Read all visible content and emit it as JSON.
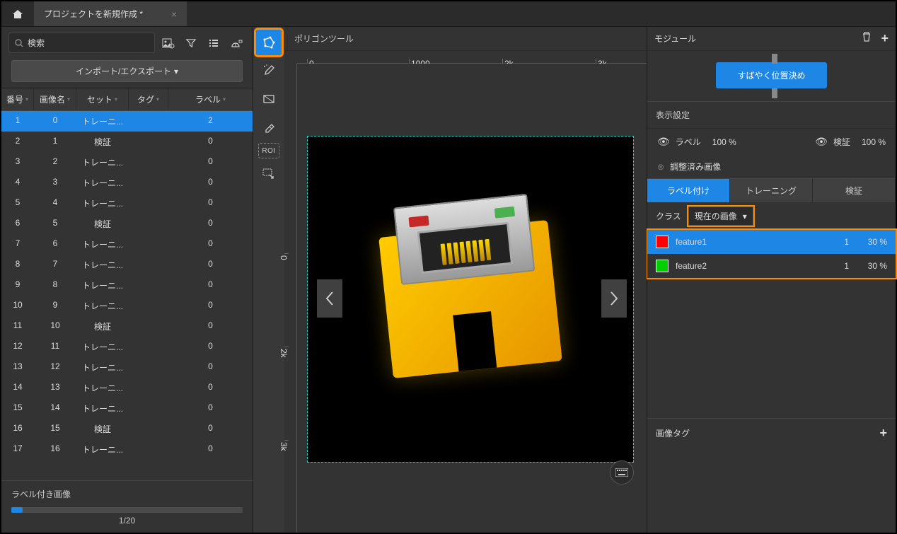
{
  "tab": {
    "title": "プロジェクトを新規作成 *"
  },
  "search": {
    "placeholder": "検索"
  },
  "import_export": "インポート/エクスポート",
  "columns": {
    "num": "番号",
    "img": "画像名",
    "set": "セット",
    "tag": "タグ",
    "label": "ラベル"
  },
  "rows": [
    {
      "n": "1",
      "img": "0",
      "set": "トレーニ...",
      "label": "2"
    },
    {
      "n": "2",
      "img": "1",
      "set": "検証",
      "label": "0"
    },
    {
      "n": "3",
      "img": "2",
      "set": "トレーニ...",
      "label": "0"
    },
    {
      "n": "4",
      "img": "3",
      "set": "トレーニ...",
      "label": "0"
    },
    {
      "n": "5",
      "img": "4",
      "set": "トレーニ...",
      "label": "0"
    },
    {
      "n": "6",
      "img": "5",
      "set": "検証",
      "label": "0"
    },
    {
      "n": "7",
      "img": "6",
      "set": "トレーニ...",
      "label": "0"
    },
    {
      "n": "8",
      "img": "7",
      "set": "トレーニ...",
      "label": "0"
    },
    {
      "n": "9",
      "img": "8",
      "set": "トレーニ...",
      "label": "0"
    },
    {
      "n": "10",
      "img": "9",
      "set": "トレーニ...",
      "label": "0"
    },
    {
      "n": "11",
      "img": "10",
      "set": "検証",
      "label": "0"
    },
    {
      "n": "12",
      "img": "11",
      "set": "トレーニ...",
      "label": "0"
    },
    {
      "n": "13",
      "img": "12",
      "set": "トレーニ...",
      "label": "0"
    },
    {
      "n": "14",
      "img": "13",
      "set": "トレーニ...",
      "label": "0"
    },
    {
      "n": "15",
      "img": "14",
      "set": "トレーニ...",
      "label": "0"
    },
    {
      "n": "16",
      "img": "15",
      "set": "検証",
      "label": "0"
    },
    {
      "n": "17",
      "img": "16",
      "set": "トレーニ...",
      "label": "0"
    }
  ],
  "progress": {
    "label": "ラベル付き画像",
    "text": "1/20"
  },
  "canvas": {
    "title": "ポリゴンツール"
  },
  "ruler_h": [
    "0",
    "1000",
    "2k",
    "3k"
  ],
  "ruler_v": [
    "0",
    "2k",
    "3k"
  ],
  "module": {
    "title": "モジュール",
    "quick": "すばやく位置決め"
  },
  "display": {
    "title": "表示設定",
    "label": "ラベル",
    "label_pct": "100 %",
    "verify": "検証",
    "verify_pct": "100 %",
    "adjusted": "調整済み画像"
  },
  "subtabs": {
    "labeling": "ラベル付け",
    "training": "トレーニング",
    "verify": "検証"
  },
  "class": {
    "label": "クラス",
    "selected": "現在の画像"
  },
  "features": [
    {
      "name": "feature1",
      "color": "#ff0000",
      "count": "1",
      "pct": "30 %"
    },
    {
      "name": "feature2",
      "color": "#00d000",
      "count": "1",
      "pct": "30 %"
    }
  ],
  "image_tag": "画像タグ"
}
